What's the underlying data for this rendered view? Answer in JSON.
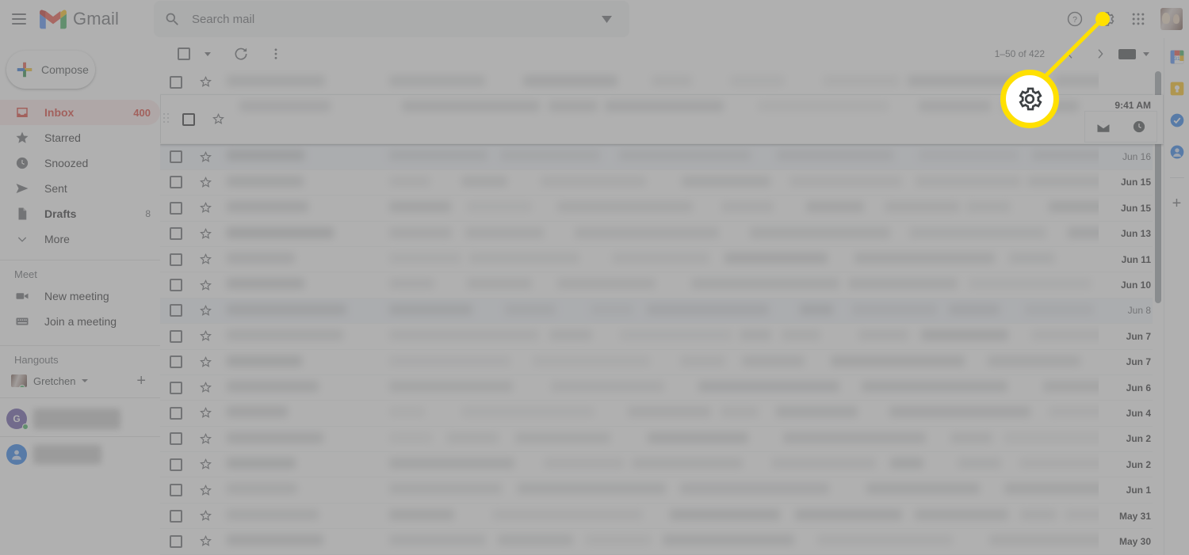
{
  "app": {
    "name": "Gmail",
    "menu_icon": "hamburger-icon"
  },
  "search": {
    "placeholder": "Search mail",
    "value": "",
    "icon": "search-icon",
    "options_icon": "chevron-down-icon"
  },
  "header_right": {
    "help_label": "?",
    "help_icon": "help-icon",
    "settings_icon": "gear-icon",
    "apps_icon": "apps-grid-icon",
    "avatar_icon": "profile-avatar"
  },
  "sidebar": {
    "compose": {
      "label": "Compose",
      "icon": "plus-icon"
    },
    "items": [
      {
        "label": "Inbox",
        "icon": "inbox-icon",
        "count": "400",
        "active": true,
        "bold": true
      },
      {
        "label": "Starred",
        "icon": "star-icon",
        "count": "",
        "active": false,
        "bold": false
      },
      {
        "label": "Snoozed",
        "icon": "clock-icon",
        "count": "",
        "active": false,
        "bold": false
      },
      {
        "label": "Sent",
        "icon": "send-icon",
        "count": "",
        "active": false,
        "bold": false
      },
      {
        "label": "Drafts",
        "icon": "draft-icon",
        "count": "8",
        "active": false,
        "bold": true
      },
      {
        "label": "More",
        "icon": "chevron-down-icon",
        "count": "",
        "active": false,
        "bold": false
      }
    ],
    "meet": {
      "title": "Meet",
      "items": [
        {
          "label": "New meeting",
          "icon": "video-camera-icon"
        },
        {
          "label": "Join a meeting",
          "icon": "keyboard-icon"
        }
      ]
    },
    "hangouts": {
      "title": "Hangouts",
      "user": {
        "name": "Gretchen",
        "status": "online",
        "caret_icon": "caret-down-icon",
        "add_icon": "plus-icon"
      },
      "contacts": [
        {
          "initial": "G",
          "color": "#5c4ba1",
          "status": "online"
        },
        {
          "initial": "",
          "color": "#1a73e8",
          "status": ""
        }
      ]
    }
  },
  "toolbar": {
    "select_all": {
      "icon": "checkbox-icon",
      "caret_icon": "caret-down-icon"
    },
    "refresh": {
      "icon": "refresh-icon"
    },
    "more": {
      "icon": "more-vertical-icon"
    },
    "pagination": {
      "range": "1–50 of 422",
      "prev_icon": "chevron-left-icon",
      "next_icon": "chevron-right-icon"
    },
    "input_tools": {
      "icon": "keyboard-icon",
      "caret_icon": "caret-down-icon"
    }
  },
  "maillist": {
    "hover_row": {
      "time": "9:41 AM",
      "actions": [
        {
          "icon": "mark-as-read-icon"
        },
        {
          "icon": "snooze-clock-icon"
        }
      ],
      "drag_handle_icon": "drag-handle-icon"
    },
    "rows": [
      {
        "date": "",
        "read": false,
        "hover": false,
        "state": "top-partial"
      },
      {
        "date": "",
        "read": false,
        "hover": true,
        "state": "hovered"
      },
      {
        "date": "Jun 16",
        "read": true,
        "hover": false,
        "state": "read"
      },
      {
        "date": "Jun 15",
        "read": false,
        "hover": false,
        "state": "unread"
      },
      {
        "date": "Jun 15",
        "read": false,
        "hover": false,
        "state": "unread"
      },
      {
        "date": "Jun 13",
        "read": false,
        "hover": false,
        "state": "unread"
      },
      {
        "date": "Jun 11",
        "read": false,
        "hover": false,
        "state": "unread"
      },
      {
        "date": "Jun 10",
        "read": false,
        "hover": false,
        "state": "unread"
      },
      {
        "date": "Jun 8",
        "read": true,
        "hover": false,
        "state": "read"
      },
      {
        "date": "Jun 7",
        "read": false,
        "hover": false,
        "state": "unread"
      },
      {
        "date": "Jun 7",
        "read": false,
        "hover": false,
        "state": "unread"
      },
      {
        "date": "Jun 6",
        "read": false,
        "hover": false,
        "state": "unread"
      },
      {
        "date": "Jun 4",
        "read": false,
        "hover": false,
        "state": "unread"
      },
      {
        "date": "Jun 2",
        "read": false,
        "hover": false,
        "state": "unread"
      },
      {
        "date": "Jun 2",
        "read": false,
        "hover": false,
        "state": "unread"
      },
      {
        "date": "Jun 1",
        "read": false,
        "hover": false,
        "state": "unread"
      },
      {
        "date": "May 31",
        "read": false,
        "hover": false,
        "state": "unread"
      },
      {
        "date": "May 30",
        "read": false,
        "hover": false,
        "state": "unread"
      }
    ],
    "scrollbar": {
      "icon": "scrollbar-thumb"
    }
  },
  "right_rail": {
    "items": [
      {
        "icon": "google-calendar-icon",
        "color": "#1a73e8"
      },
      {
        "icon": "google-keep-icon",
        "color": "#fbbc04"
      },
      {
        "icon": "google-tasks-icon",
        "color": "#1a73e8"
      },
      {
        "icon": "google-contacts-icon",
        "color": "#1a73e8"
      }
    ],
    "add": {
      "icon": "plus-icon"
    }
  },
  "callout": {
    "target": "settings-gear",
    "highlight_color": "#ffe000",
    "icon": "gear-icon"
  }
}
